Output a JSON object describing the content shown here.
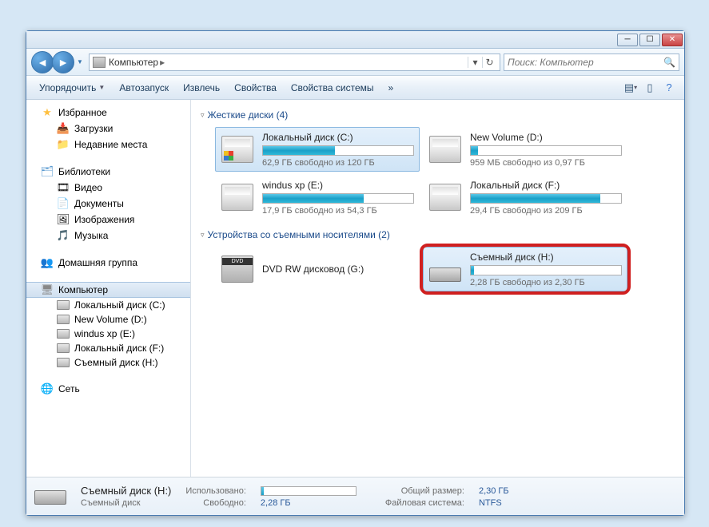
{
  "titlebar": {},
  "address": {
    "location": "Компьютер"
  },
  "search": {
    "placeholder": "Поиск: Компьютер"
  },
  "toolbar": {
    "organize": "Упорядочить",
    "autorun": "Автозапуск",
    "eject": "Извлечь",
    "properties": "Свойства",
    "sysprops": "Свойства системы",
    "more": "»"
  },
  "sidebar": {
    "favorites": {
      "label": "Избранное",
      "downloads": "Загрузки",
      "recent": "Недавние места"
    },
    "libraries": {
      "label": "Библиотеки",
      "video": "Видео",
      "documents": "Документы",
      "pictures": "Изображения",
      "music": "Музыка"
    },
    "homegroup": {
      "label": "Домашняя группа"
    },
    "computer": {
      "label": "Компьютер",
      "drives": [
        "Локальный диск (C:)",
        "New Volume (D:)",
        "windus xp (E:)",
        "Локальный диск (F:)",
        "Съемный диск (H:)"
      ]
    },
    "network": {
      "label": "Сеть"
    }
  },
  "main": {
    "section1": {
      "title": "Жесткие диски (4)"
    },
    "section2": {
      "title": "Устройства со съемными носителями (2)"
    },
    "drives": {
      "c": {
        "name": "Локальный диск (C:)",
        "free": "62,9 ГБ свободно из 120 ГБ",
        "fill": 48
      },
      "d": {
        "name": "New Volume (D:)",
        "free": "959 МБ свободно из 0,97 ГБ",
        "fill": 5
      },
      "e": {
        "name": "windus xp (E:)",
        "free": "17,9 ГБ свободно из 54,3 ГБ",
        "fill": 67
      },
      "f": {
        "name": "Локальный диск (F:)",
        "free": "29,4 ГБ свободно из 209 ГБ",
        "fill": 86
      },
      "g": {
        "name": "DVD RW дисковод (G:)"
      },
      "h": {
        "name": "Съемный диск (H:)",
        "free": "2,28 ГБ свободно из 2,30 ГБ",
        "fill": 2
      }
    }
  },
  "status": {
    "title": "Съемный диск (H:)",
    "subtitle": "Съемный диск",
    "used_label": "Использовано:",
    "free_label": "Свободно:",
    "free_val": "2,28 ГБ",
    "total_label": "Общий размер:",
    "total_val": "2,30 ГБ",
    "fs_label": "Файловая система:",
    "fs_val": "NTFS"
  }
}
